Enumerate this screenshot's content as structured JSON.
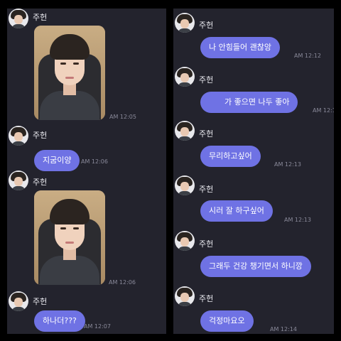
{
  "sender_name": "주헌",
  "left_panel": {
    "messages": [
      {
        "kind": "photo",
        "time": "AM 12:05"
      },
      {
        "kind": "text",
        "text": "지굼이양",
        "time": "AM 12:06"
      },
      {
        "kind": "photo",
        "time": "AM 12:06"
      },
      {
        "kind": "text",
        "text": "하나더???",
        "time": "AM 12:07"
      }
    ]
  },
  "right_panel": {
    "messages": [
      {
        "text": "나 안힘들어 괜찮앙",
        "time": "AM 12:12"
      },
      {
        "text": "가 좋으면 나두 좋아",
        "time": "AM 12:1"
      },
      {
        "text": "무리하고싶어",
        "time": "AM 12:13"
      },
      {
        "text": "시러 잘 하구싶어",
        "time": "AM 12:13"
      },
      {
        "text": "그래두 건강 챙기면서 하니깡",
        "time": ""
      },
      {
        "text": "걱정마요오",
        "time": "AM 12:14"
      }
    ]
  },
  "colors": {
    "background": "#000000",
    "panel": "#23232d",
    "bubble": "#6f72e4",
    "timestamp": "#8a8a9a"
  },
  "icons": [
    "avatar",
    "selfie-photo"
  ]
}
